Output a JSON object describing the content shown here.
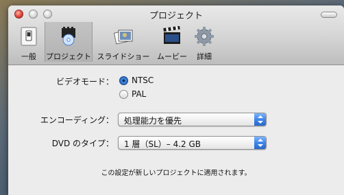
{
  "window": {
    "title": "プロジェクト"
  },
  "toolbar": {
    "items": [
      {
        "label": "一般",
        "icon": "switch-icon",
        "selected": false
      },
      {
        "label": "プロジェクト",
        "icon": "project-icon",
        "selected": true
      },
      {
        "label": "スライドショー",
        "icon": "slideshow-icon",
        "selected": false
      },
      {
        "label": "ムービー",
        "icon": "clapperboard-icon",
        "selected": false
      },
      {
        "label": "詳細",
        "icon": "gear-icon",
        "selected": false
      }
    ]
  },
  "settings": {
    "video_mode": {
      "label": "ビデオモード：",
      "options": [
        {
          "label": "NTSC",
          "selected": true
        },
        {
          "label": "PAL",
          "selected": false
        }
      ]
    },
    "encoding": {
      "label": "エンコーディング：",
      "value": "処理能力を優先"
    },
    "dvd_type": {
      "label": "DVD のタイプ：",
      "value": "1 層（SL）– 4.2 GB"
    },
    "note": "この設定が新しいプロジェクトに適用されます。"
  },
  "colors": {
    "accent": "#3f86ea",
    "close_button": "#e0443a"
  }
}
